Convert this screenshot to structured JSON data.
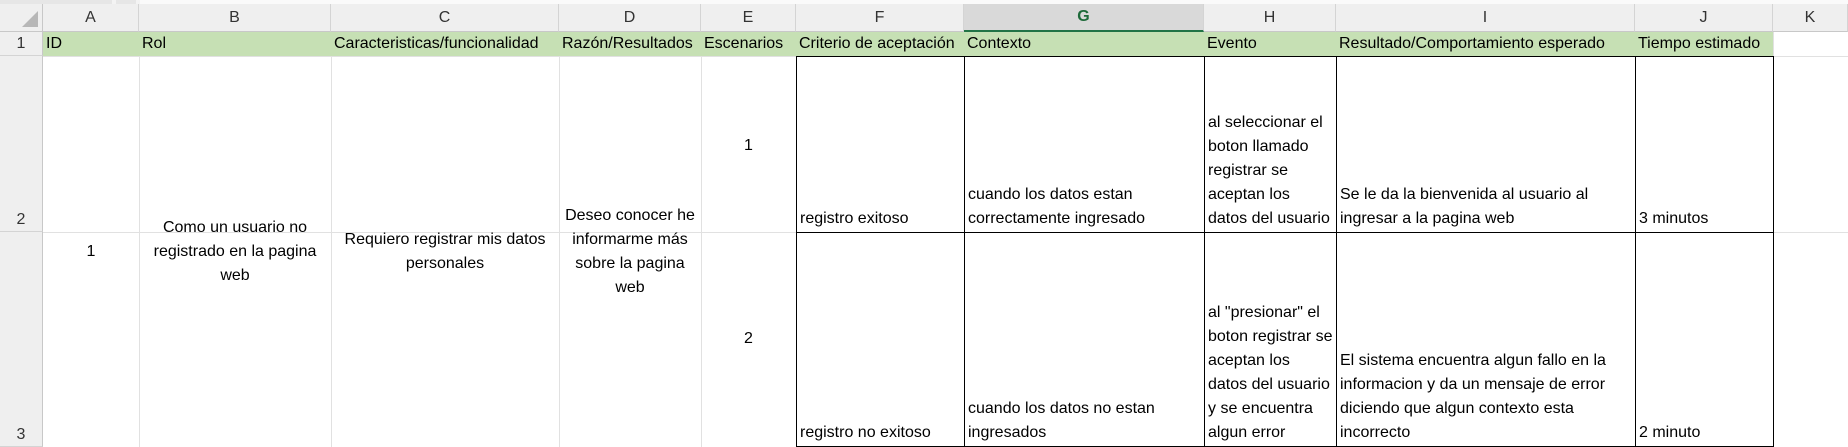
{
  "column_headers": [
    "A",
    "B",
    "C",
    "D",
    "E",
    "F",
    "G",
    "H",
    "I",
    "J",
    "K"
  ],
  "row_numbers": [
    "1",
    "2",
    "3"
  ],
  "selected_column": "G",
  "accent_colors": {
    "header_fill": "#c6e0b4",
    "selected_col": "#217346"
  },
  "table": {
    "headers": [
      "ID",
      "Rol",
      "Caracteristicas/funcionalidad",
      "Razón/Resultados",
      "Escenarios",
      "Criterio de aceptación",
      "Contexto",
      "Evento",
      "Resultado/Comportamiento esperado",
      "Tiempo estimado"
    ],
    "story": {
      "id": "1",
      "rol": "Como un usuario no registrado en la pagina web",
      "caracteristicas": "Requiero registrar mis datos personales",
      "razon": "Deseo conocer he informarme más sobre la pagina web"
    },
    "scenarios": [
      {
        "escenario": "1",
        "criterio": "registro exitoso",
        "contexto": "cuando los datos estan correctamente ingresado",
        "evento": "al seleccionar el boton llamado registrar se aceptan los datos del usuario",
        "resultado": "Se le da la bienvenida al usuario al ingresar a la pagina web",
        "tiempo": "3 minutos"
      },
      {
        "escenario": "2",
        "criterio": "registro no exitoso",
        "contexto": "cuando los datos no estan ingresados",
        "evento": "al \"presionar\" el boton registrar se aceptan los datos del usuario y se encuentra algun error",
        "resultado": "El sistema encuentra algun fallo en la informacion y da un mensaje de error diciendo que algun contexto esta incorrecto",
        "tiempo": "2 minuto"
      }
    ]
  }
}
